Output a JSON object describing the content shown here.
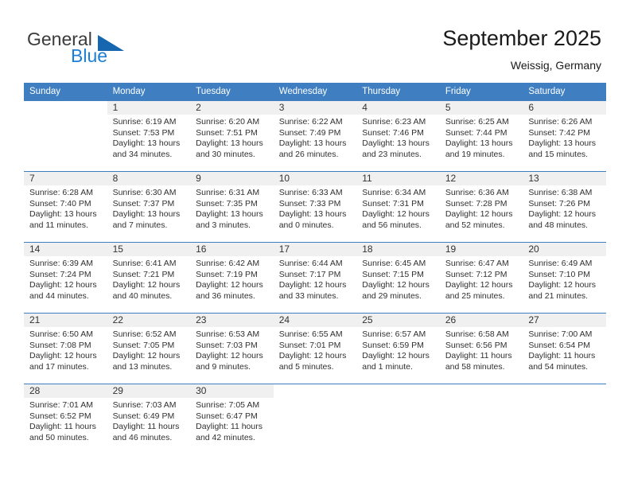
{
  "brand": {
    "name_top": "General",
    "name_bottom": "Blue",
    "triangle_color": "#1666b0",
    "accent_color": "#1c7fd6"
  },
  "header": {
    "title": "September 2025",
    "subtitle": "Weissig, Germany"
  },
  "calendar": {
    "header_bg": "#3f7fc1",
    "daynum_bg": "#f0f0f0",
    "weekdays": [
      "Sunday",
      "Monday",
      "Tuesday",
      "Wednesday",
      "Thursday",
      "Friday",
      "Saturday"
    ],
    "weeks": [
      [
        {
          "day": "",
          "sunrise": "",
          "sunset": "",
          "daylight": ""
        },
        {
          "day": "1",
          "sunrise": "Sunrise: 6:19 AM",
          "sunset": "Sunset: 7:53 PM",
          "daylight": "Daylight: 13 hours and 34 minutes."
        },
        {
          "day": "2",
          "sunrise": "Sunrise: 6:20 AM",
          "sunset": "Sunset: 7:51 PM",
          "daylight": "Daylight: 13 hours and 30 minutes."
        },
        {
          "day": "3",
          "sunrise": "Sunrise: 6:22 AM",
          "sunset": "Sunset: 7:49 PM",
          "daylight": "Daylight: 13 hours and 26 minutes."
        },
        {
          "day": "4",
          "sunrise": "Sunrise: 6:23 AM",
          "sunset": "Sunset: 7:46 PM",
          "daylight": "Daylight: 13 hours and 23 minutes."
        },
        {
          "day": "5",
          "sunrise": "Sunrise: 6:25 AM",
          "sunset": "Sunset: 7:44 PM",
          "daylight": "Daylight: 13 hours and 19 minutes."
        },
        {
          "day": "6",
          "sunrise": "Sunrise: 6:26 AM",
          "sunset": "Sunset: 7:42 PM",
          "daylight": "Daylight: 13 hours and 15 minutes."
        }
      ],
      [
        {
          "day": "7",
          "sunrise": "Sunrise: 6:28 AM",
          "sunset": "Sunset: 7:40 PM",
          "daylight": "Daylight: 13 hours and 11 minutes."
        },
        {
          "day": "8",
          "sunrise": "Sunrise: 6:30 AM",
          "sunset": "Sunset: 7:37 PM",
          "daylight": "Daylight: 13 hours and 7 minutes."
        },
        {
          "day": "9",
          "sunrise": "Sunrise: 6:31 AM",
          "sunset": "Sunset: 7:35 PM",
          "daylight": "Daylight: 13 hours and 3 minutes."
        },
        {
          "day": "10",
          "sunrise": "Sunrise: 6:33 AM",
          "sunset": "Sunset: 7:33 PM",
          "daylight": "Daylight: 13 hours and 0 minutes."
        },
        {
          "day": "11",
          "sunrise": "Sunrise: 6:34 AM",
          "sunset": "Sunset: 7:31 PM",
          "daylight": "Daylight: 12 hours and 56 minutes."
        },
        {
          "day": "12",
          "sunrise": "Sunrise: 6:36 AM",
          "sunset": "Sunset: 7:28 PM",
          "daylight": "Daylight: 12 hours and 52 minutes."
        },
        {
          "day": "13",
          "sunrise": "Sunrise: 6:38 AM",
          "sunset": "Sunset: 7:26 PM",
          "daylight": "Daylight: 12 hours and 48 minutes."
        }
      ],
      [
        {
          "day": "14",
          "sunrise": "Sunrise: 6:39 AM",
          "sunset": "Sunset: 7:24 PM",
          "daylight": "Daylight: 12 hours and 44 minutes."
        },
        {
          "day": "15",
          "sunrise": "Sunrise: 6:41 AM",
          "sunset": "Sunset: 7:21 PM",
          "daylight": "Daylight: 12 hours and 40 minutes."
        },
        {
          "day": "16",
          "sunrise": "Sunrise: 6:42 AM",
          "sunset": "Sunset: 7:19 PM",
          "daylight": "Daylight: 12 hours and 36 minutes."
        },
        {
          "day": "17",
          "sunrise": "Sunrise: 6:44 AM",
          "sunset": "Sunset: 7:17 PM",
          "daylight": "Daylight: 12 hours and 33 minutes."
        },
        {
          "day": "18",
          "sunrise": "Sunrise: 6:45 AM",
          "sunset": "Sunset: 7:15 PM",
          "daylight": "Daylight: 12 hours and 29 minutes."
        },
        {
          "day": "19",
          "sunrise": "Sunrise: 6:47 AM",
          "sunset": "Sunset: 7:12 PM",
          "daylight": "Daylight: 12 hours and 25 minutes."
        },
        {
          "day": "20",
          "sunrise": "Sunrise: 6:49 AM",
          "sunset": "Sunset: 7:10 PM",
          "daylight": "Daylight: 12 hours and 21 minutes."
        }
      ],
      [
        {
          "day": "21",
          "sunrise": "Sunrise: 6:50 AM",
          "sunset": "Sunset: 7:08 PM",
          "daylight": "Daylight: 12 hours and 17 minutes."
        },
        {
          "day": "22",
          "sunrise": "Sunrise: 6:52 AM",
          "sunset": "Sunset: 7:05 PM",
          "daylight": "Daylight: 12 hours and 13 minutes."
        },
        {
          "day": "23",
          "sunrise": "Sunrise: 6:53 AM",
          "sunset": "Sunset: 7:03 PM",
          "daylight": "Daylight: 12 hours and 9 minutes."
        },
        {
          "day": "24",
          "sunrise": "Sunrise: 6:55 AM",
          "sunset": "Sunset: 7:01 PM",
          "daylight": "Daylight: 12 hours and 5 minutes."
        },
        {
          "day": "25",
          "sunrise": "Sunrise: 6:57 AM",
          "sunset": "Sunset: 6:59 PM",
          "daylight": "Daylight: 12 hours and 1 minute."
        },
        {
          "day": "26",
          "sunrise": "Sunrise: 6:58 AM",
          "sunset": "Sunset: 6:56 PM",
          "daylight": "Daylight: 11 hours and 58 minutes."
        },
        {
          "day": "27",
          "sunrise": "Sunrise: 7:00 AM",
          "sunset": "Sunset: 6:54 PM",
          "daylight": "Daylight: 11 hours and 54 minutes."
        }
      ],
      [
        {
          "day": "28",
          "sunrise": "Sunrise: 7:01 AM",
          "sunset": "Sunset: 6:52 PM",
          "daylight": "Daylight: 11 hours and 50 minutes."
        },
        {
          "day": "29",
          "sunrise": "Sunrise: 7:03 AM",
          "sunset": "Sunset: 6:49 PM",
          "daylight": "Daylight: 11 hours and 46 minutes."
        },
        {
          "day": "30",
          "sunrise": "Sunrise: 7:05 AM",
          "sunset": "Sunset: 6:47 PM",
          "daylight": "Daylight: 11 hours and 42 minutes."
        },
        {
          "day": "",
          "sunrise": "",
          "sunset": "",
          "daylight": ""
        },
        {
          "day": "",
          "sunrise": "",
          "sunset": "",
          "daylight": ""
        },
        {
          "day": "",
          "sunrise": "",
          "sunset": "",
          "daylight": ""
        },
        {
          "day": "",
          "sunrise": "",
          "sunset": "",
          "daylight": ""
        }
      ]
    ]
  }
}
